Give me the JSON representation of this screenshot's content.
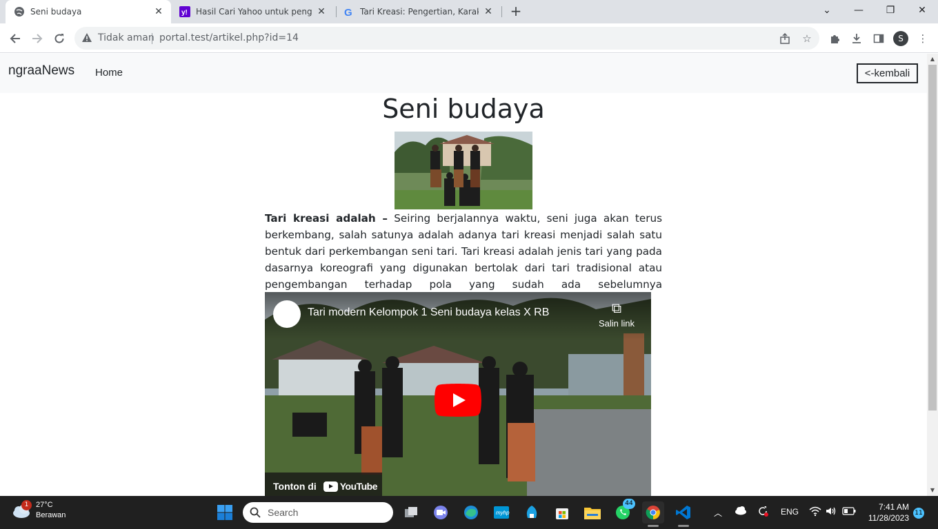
{
  "browser": {
    "tabs": [
      {
        "title": "Seni budaya",
        "active": true
      },
      {
        "title": "Hasil Cari Yahoo untuk pengertian",
        "active": false
      },
      {
        "title": "Tari Kreasi: Pengertian, Karakteristik",
        "active": false
      }
    ],
    "address": {
      "security_label": "Tidak aman",
      "url": "portal.test/artikel.php?id=14"
    },
    "profile_initial": "S"
  },
  "page": {
    "brand": "ngraaNews",
    "nav_home": "Home",
    "back_button": "<-kembali",
    "title": "Seni budaya",
    "lead_bold": "Tari kreasi adalah –",
    "body": " Seiring berjalannya waktu, seni juga akan terus berkembang, salah satunya adalah adanya tari kreasi menjadi salah satu bentuk dari perkembangan seni tari. Tari kreasi adalah jenis tari yang pada dasarnya koreografi yang digunakan bertolak dari tari tradisional atau pengembangan terhadap pola yang sudah ada sebelumnya",
    "video": {
      "title": "Tari modern Kelompok 1 Seni budaya kelas X RB",
      "copy_link": "Salin link",
      "watch_on": "Tonton di",
      "platform": "YouTube"
    }
  },
  "taskbar": {
    "weather_temp": "27°C",
    "weather_desc": "Berawan",
    "weather_badge": "1",
    "search_placeholder": "Search",
    "whatsapp_badge": "44",
    "language": "ENG",
    "time": "7:41 AM",
    "date": "11/28/2023",
    "notification_count": "11"
  },
  "colors": {
    "tabstrip": "#dee1e6",
    "navbar_bg": "#f8f9fa",
    "taskbar": "#202020",
    "youtube_red": "#ff0000"
  }
}
